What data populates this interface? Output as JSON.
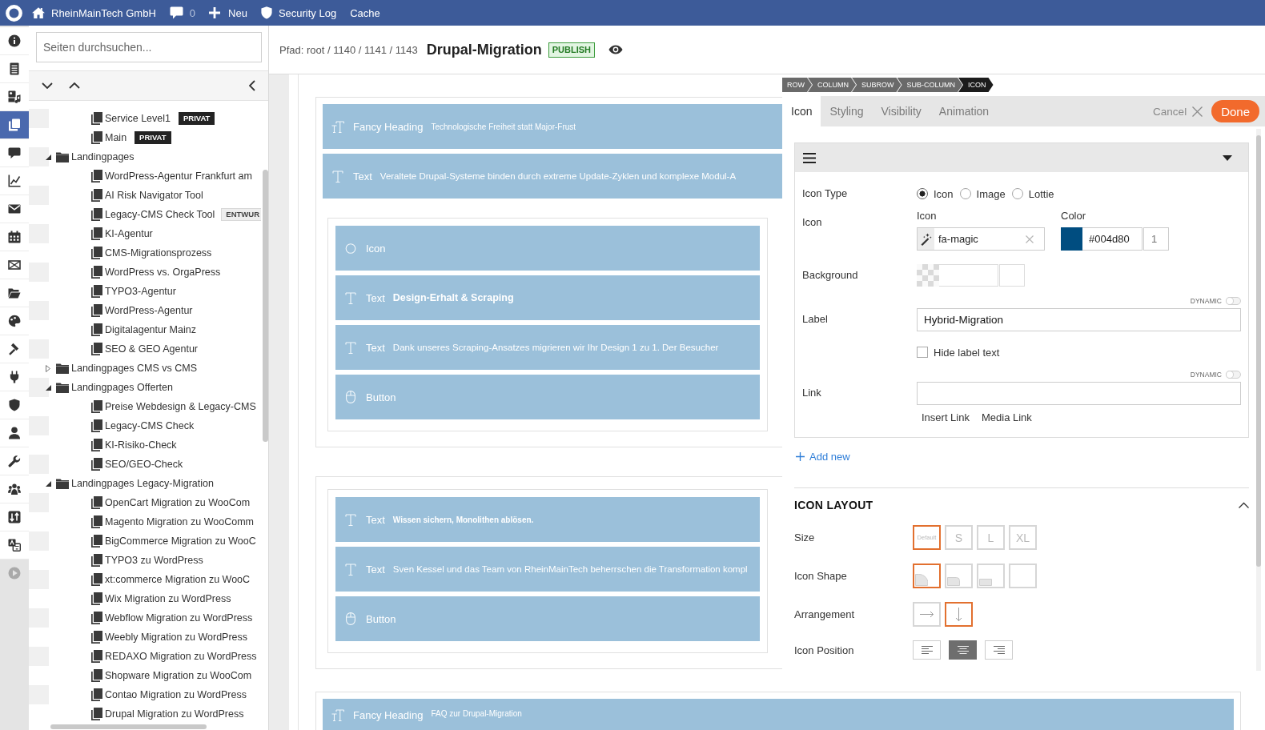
{
  "top_bar": {
    "site": "RheinMainTech GmbH",
    "comment_count": "0",
    "new": "Neu",
    "security_log": "Security Log",
    "cache": "Cache"
  },
  "rail": [
    {
      "selected": false,
      "disabled": false
    },
    {
      "selected": false,
      "disabled": false
    },
    {
      "selected": false,
      "disabled": false
    },
    {
      "selected": true,
      "disabled": false
    },
    {
      "selected": false,
      "disabled": false
    },
    {
      "selected": false,
      "disabled": false
    },
    {
      "selected": false,
      "disabled": false
    },
    {
      "selected": false,
      "disabled": false
    },
    {
      "selected": false,
      "disabled": false
    },
    {
      "selected": false,
      "disabled": false
    },
    {
      "selected": false,
      "disabled": false
    },
    {
      "selected": false,
      "disabled": false
    },
    {
      "selected": false,
      "disabled": false
    },
    {
      "selected": false,
      "disabled": false
    },
    {
      "selected": false,
      "disabled": false
    },
    {
      "selected": false,
      "disabled": false
    },
    {
      "selected": false,
      "disabled": false
    },
    {
      "selected": false,
      "disabled": false
    },
    {
      "selected": false,
      "disabled": false
    },
    {
      "selected": false,
      "disabled": true
    }
  ],
  "sidebar": {
    "search": {
      "placeholder": "Seiten durchsuchen..."
    },
    "tree": [
      {
        "children": [
          {
            "kind": "page",
            "label": "Service Level1",
            "badge": {
              "kind": "private",
              "label": "PRIVAT"
            }
          },
          {
            "kind": "page",
            "label": "Main",
            "badge": {
              "kind": "private",
              "label": "PRIVAT"
            }
          }
        ]
      },
      {
        "kind": "folder",
        "label": "Landingpages",
        "expanded": true,
        "children": [
          {
            "kind": "page",
            "label": "WordPress-Agentur Frankfurt am"
          },
          {
            "kind": "page",
            "label": "AI Risk Navigator Tool"
          },
          {
            "kind": "page",
            "label": "Legacy-CMS Check Tool",
            "badge": {
              "kind": "draft",
              "label": "ENTWUR"
            }
          },
          {
            "kind": "page",
            "label": "KI-Agentur"
          },
          {
            "kind": "page",
            "label": "CMS-Migrationsprozess"
          },
          {
            "kind": "page",
            "label": "WordPress vs. OrgaPress"
          },
          {
            "kind": "page",
            "label": "TYPO3-Agentur"
          },
          {
            "kind": "page",
            "label": "WordPress-Agentur"
          },
          {
            "kind": "page",
            "label": "Digitalagentur Mainz"
          },
          {
            "kind": "page",
            "label": "SEO & GEO Agentur"
          }
        ]
      },
      {
        "kind": "folder",
        "label": "Landingpages CMS vs CMS",
        "expanded": false
      },
      {
        "kind": "folder",
        "label": "Landingpages Offerten",
        "expanded": true,
        "children": [
          {
            "kind": "page",
            "label": "Preise Webdesign & Legacy-CMS"
          },
          {
            "kind": "page",
            "label": "Legacy-CMS Check"
          },
          {
            "kind": "page",
            "label": "KI-Risiko-Check"
          },
          {
            "kind": "page",
            "label": "SEO/GEO-Check"
          }
        ]
      },
      {
        "kind": "folder",
        "label": "Landingpages Legacy-Migration",
        "expanded": true,
        "children": [
          {
            "kind": "page",
            "label": "OpenCart Migration zu WooCom"
          },
          {
            "kind": "page",
            "label": "Magento Migration zu WooComm"
          },
          {
            "kind": "page",
            "label": "BigCommerce Migration zu WooC"
          },
          {
            "kind": "page",
            "label": "TYPO3 zu WordPress"
          },
          {
            "kind": "page",
            "label": "xt:commerce Migration zu WooC"
          },
          {
            "kind": "page",
            "label": "Wix Migration zu WordPress"
          },
          {
            "kind": "page",
            "label": "Webflow Migration zu WordPress"
          },
          {
            "kind": "page",
            "label": "Weebly Migration zu WordPress"
          },
          {
            "kind": "page",
            "label": "REDAXO Migration zu WordPress"
          },
          {
            "kind": "page",
            "label": "Shopware Migration zu WooCom"
          },
          {
            "kind": "page",
            "label": "Contao Migration zu WordPress"
          },
          {
            "kind": "page",
            "label": "Drupal Migration zu WordPress"
          }
        ]
      }
    ]
  },
  "header": {
    "path": "Pfad: root / 1140 / 1141 / 1143",
    "title": "Drupal-Migration",
    "status": "PUBLISH"
  },
  "canvas": {
    "sections": [
      {
        "elements": [
          {
            "kind": "fancy-heading",
            "name": "Fancy Heading",
            "preview": {
              "kind": "small",
              "text": "Technologische Freiheit statt Major-Frust"
            }
          },
          {
            "kind": "text",
            "name": "Text",
            "preview": {
              "kind": "plain",
              "text": "Veraltete Drupal-Systeme binden durch extreme Update-Zyklen und komplexe Modul-A"
            }
          }
        ],
        "columns": [
          {
            "elements": [
              {
                "kind": "icon",
                "name": "Icon"
              },
              {
                "kind": "text",
                "name": "Text",
                "preview": {
                  "kind": "strong",
                  "text": "Design-Erhalt & Scraping"
                }
              },
              {
                "kind": "text",
                "name": "Text",
                "preview": {
                  "kind": "plain",
                  "text": "Dank unseres Scraping-Ansatzes migrieren wir Ihr Design 1 zu 1. Der Besucher"
                }
              },
              {
                "kind": "button",
                "name": "Button"
              }
            ]
          }
        ]
      },
      {
        "columns": [
          {
            "elements": [
              {
                "kind": "text",
                "name": "Text",
                "preview": {
                  "kind": "small-strong",
                  "text": "Wissen sichern, Monolithen ablösen."
                }
              },
              {
                "kind": "text",
                "name": "Text",
                "preview": {
                  "kind": "plain",
                  "text": "Sven Kessel und das Team von RheinMainTech beherrschen die Transformation kompl"
                }
              },
              {
                "kind": "button",
                "name": "Button"
              }
            ]
          }
        ]
      },
      {
        "elements": [
          {
            "kind": "fancy-heading",
            "name": "Fancy Heading",
            "preview": {
              "kind": "small",
              "text": "FAQ zur Drupal-Migration"
            }
          }
        ]
      }
    ]
  },
  "panel": {
    "breadcrumb": [
      {
        "label": "ROW",
        "selected": false
      },
      {
        "label": "COLUMN",
        "selected": false
      },
      {
        "label": "SUBROW",
        "selected": false
      },
      {
        "label": "SUB-COLUMN",
        "selected": false
      },
      {
        "label": "ICON",
        "selected": true
      }
    ],
    "tabs": [
      {
        "label": "Icon",
        "selected": true
      },
      {
        "label": "Styling",
        "selected": false
      },
      {
        "label": "Visibility",
        "selected": false
      },
      {
        "label": "Animation",
        "selected": false
      }
    ],
    "cancel": "Cancel",
    "done": "Done",
    "item": {
      "expanded": true,
      "fields": [
        {
          "kind": "radio",
          "label": "Icon Type",
          "options": [
            {
              "label": "Icon",
              "selected": true
            },
            {
              "label": "Image",
              "selected": false
            },
            {
              "label": "Lottie",
              "selected": false
            }
          ]
        },
        {
          "kind": "icon-color",
          "label": "Icon",
          "icon_label": "Icon",
          "icon_value": "fa-magic",
          "color_label": "Color",
          "color": "#004d80",
          "color_value": "#004d80",
          "opacity": "1"
        },
        {
          "kind": "background",
          "label": "Background"
        },
        {
          "kind": "text",
          "label": "Label",
          "dynamic": {
            "label": "DYNAMIC",
            "on": false
          },
          "value": "Hybrid-Migration",
          "checkbox": {
            "label": "Hide label text",
            "checked": false
          }
        },
        {
          "kind": "link",
          "label": "Link",
          "dynamic": {
            "label": "DYNAMIC",
            "on": false
          },
          "links": [
            "Insert Link",
            "Media Link"
          ]
        }
      ]
    },
    "add_new": "Add new",
    "layout": {
      "title": "ICON LAYOUT",
      "expanded": true,
      "rows": [
        {
          "kind": "text-options",
          "label": "Size",
          "options": [
            {
              "label": "Default",
              "selected": true
            },
            {
              "label": "S",
              "selected": false
            },
            {
              "label": "L",
              "selected": false
            },
            {
              "label": "XL",
              "selected": false
            }
          ]
        },
        {
          "kind": "shape-options",
          "label": "Icon Shape",
          "options": [
            {
              "kind": "round",
              "selected": true
            },
            {
              "kind": "rounded",
              "selected": false
            },
            {
              "kind": "square",
              "selected": false
            },
            {
              "kind": "none",
              "selected": false
            }
          ]
        },
        {
          "kind": "arrow-options",
          "label": "Arrangement",
          "options": [
            {
              "kind": "horizontal",
              "selected": false
            },
            {
              "kind": "vertical",
              "selected": true
            }
          ]
        },
        {
          "kind": "align-options",
          "label": "Icon Position",
          "options": [
            {
              "kind": "left",
              "selected": false
            },
            {
              "kind": "center",
              "selected": true
            },
            {
              "kind": "right",
              "selected": false
            }
          ]
        }
      ]
    }
  }
}
